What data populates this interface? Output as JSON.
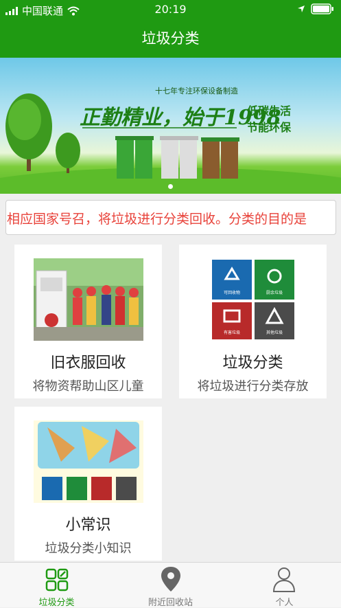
{
  "status_bar": {
    "carrier": "中国联通",
    "time": "20:19"
  },
  "header": {
    "title": "垃圾分类"
  },
  "banner": {
    "slogan_top": "十七年专注环保设备制造",
    "slogan_main": "正勤精业，始于1998",
    "slogan_side_1": "低碳生活",
    "slogan_side_2": "节能环保"
  },
  "notice": {
    "text": "相应国家号召，将垃圾进行分类回收。分类的目的是"
  },
  "cards": [
    {
      "title": "旧衣服回收",
      "subtitle": "将物资帮助山区儿童"
    },
    {
      "title": "垃圾分类",
      "subtitle": "将垃圾进行分类存放"
    },
    {
      "title": "小常识",
      "subtitle": "垃圾分类小知识"
    }
  ],
  "bin_labels": {
    "recyclable": "可回收物",
    "recyclable_en": "Recyclable",
    "kitchen": "厨余垃圾",
    "kitchen_en": "Kitchen Waste",
    "harmful": "有害垃圾",
    "harmful_en": "Harmful Waste",
    "other": "其他垃圾",
    "other_en": "Other Waste"
  },
  "tabbar": {
    "items": [
      {
        "label": "垃圾分类",
        "active": true,
        "icon": "grid-icon"
      },
      {
        "label": "附近回收站",
        "active": false,
        "icon": "location-pin-icon"
      },
      {
        "label": "个人",
        "active": false,
        "icon": "person-icon"
      }
    ]
  },
  "colors": {
    "primary_green": "#1f9a12",
    "notice_red": "#e8423a",
    "inactive_tab": "#777777"
  }
}
